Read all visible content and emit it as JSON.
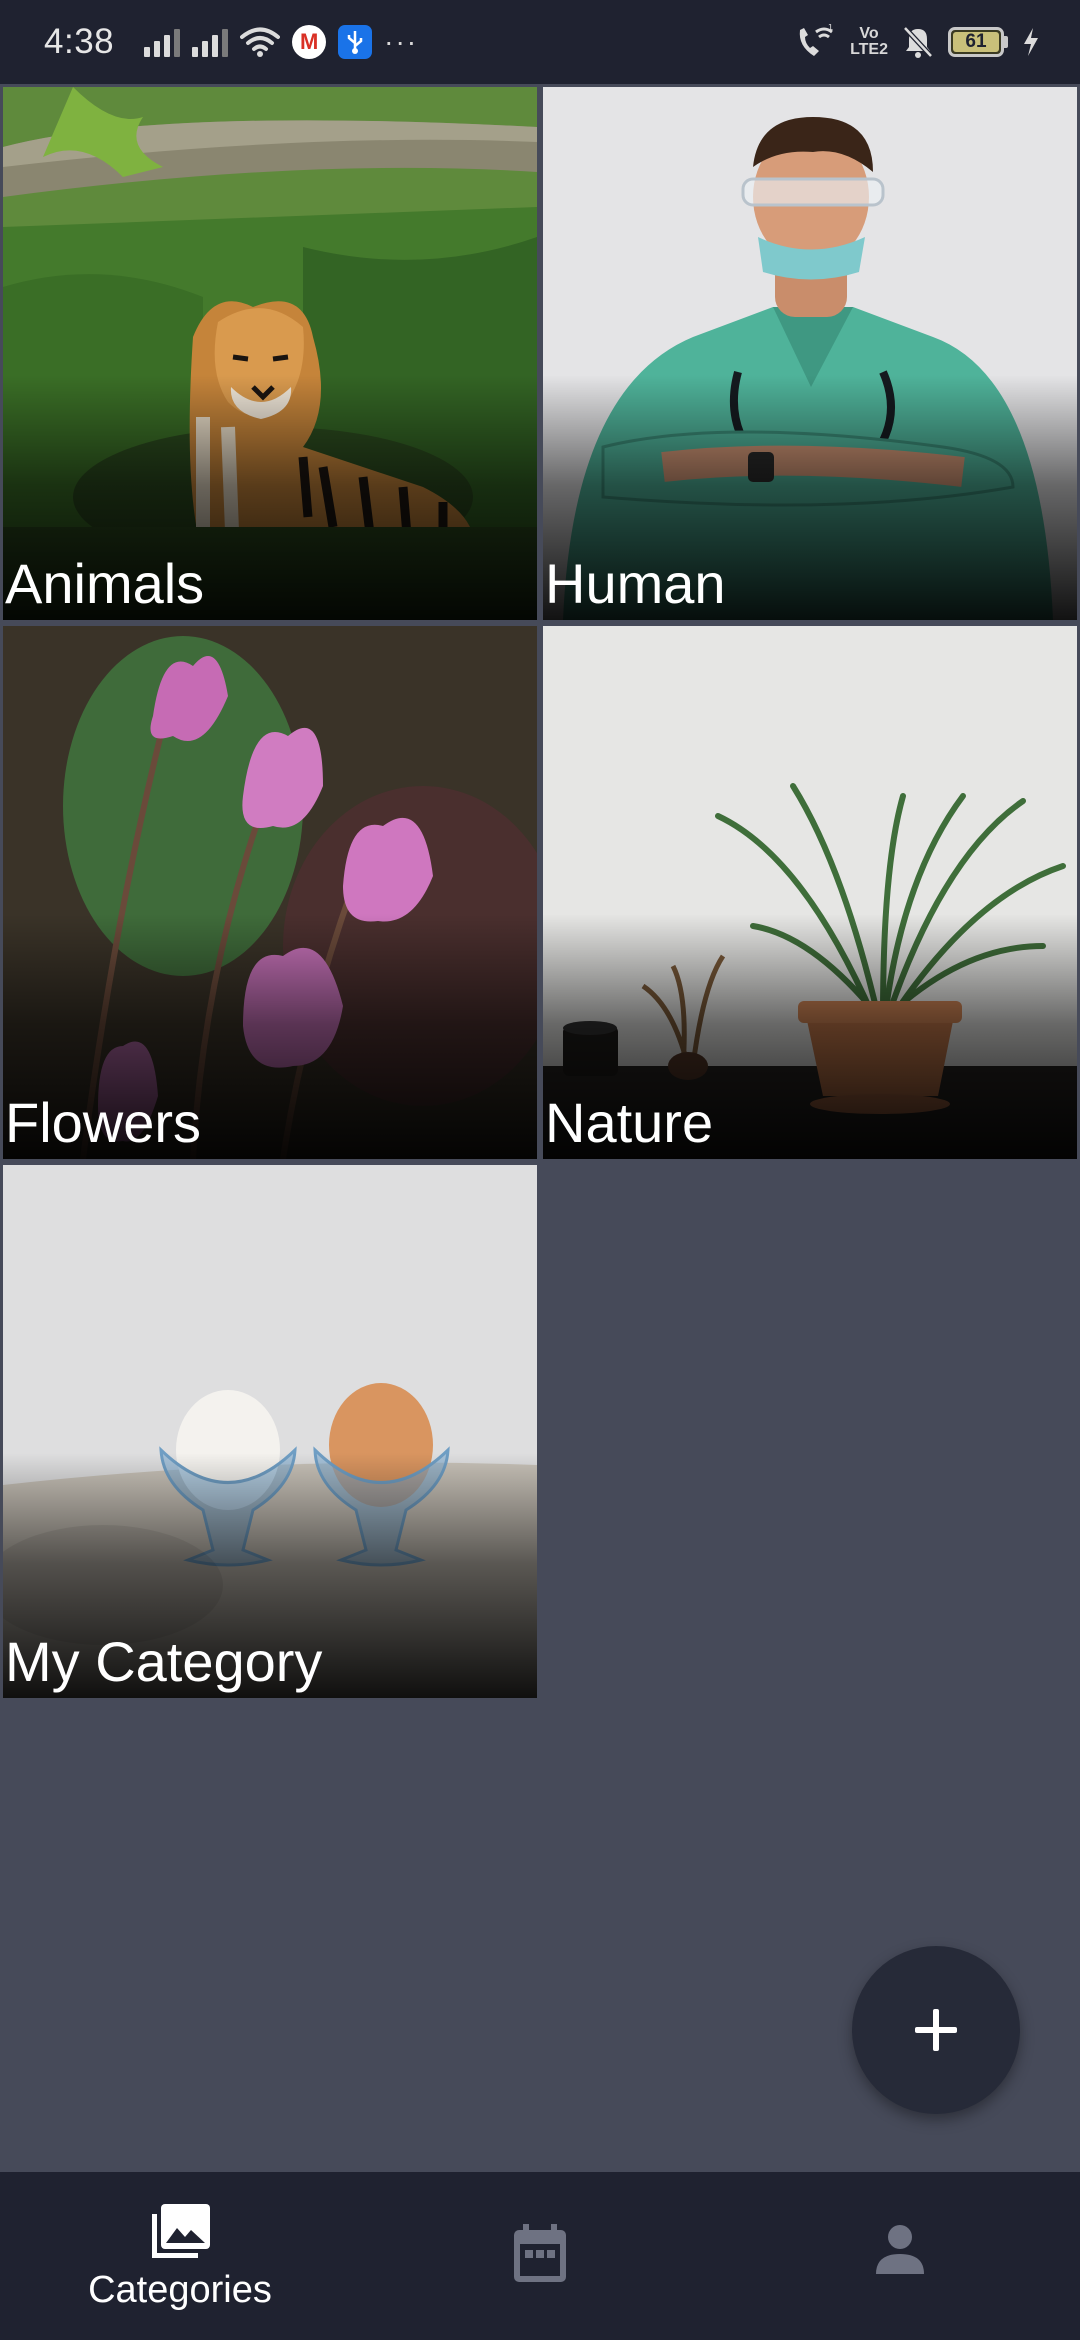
{
  "status_bar": {
    "time": "4:38",
    "battery_level": "61",
    "network_label_line1": "Vo",
    "network_label_line2": "LTE2",
    "overflow": "···",
    "icons": [
      "signal-icon",
      "signal-icon",
      "wifi-icon",
      "gmail-icon",
      "usb-icon",
      "wifi-calling-icon",
      "volte-icon",
      "mute-icon",
      "battery-icon",
      "charging-icon"
    ]
  },
  "categories": [
    {
      "label": "Animals",
      "image": "tiger-in-grass"
    },
    {
      "label": "Human",
      "image": "doctor-in-scrubs"
    },
    {
      "label": "Flowers",
      "image": "pink-cyclamen-flowers"
    },
    {
      "label": "Nature",
      "image": "potted-palm-plant"
    },
    {
      "label": "My Category",
      "image": "eggs-in-glass-cups"
    }
  ],
  "fab": {
    "icon": "plus-icon"
  },
  "bottom_nav": {
    "items": [
      {
        "label": "Categories",
        "icon": "photo-library-icon",
        "active": true
      },
      {
        "label": "",
        "icon": "calendar-icon",
        "active": false
      },
      {
        "label": "",
        "icon": "person-icon",
        "active": false
      }
    ]
  },
  "colors": {
    "background": "#464a59",
    "bars": "#1f2230",
    "fab": "#262a38",
    "inactive_icon": "#6e7282",
    "active_icon": "#ffffff"
  }
}
